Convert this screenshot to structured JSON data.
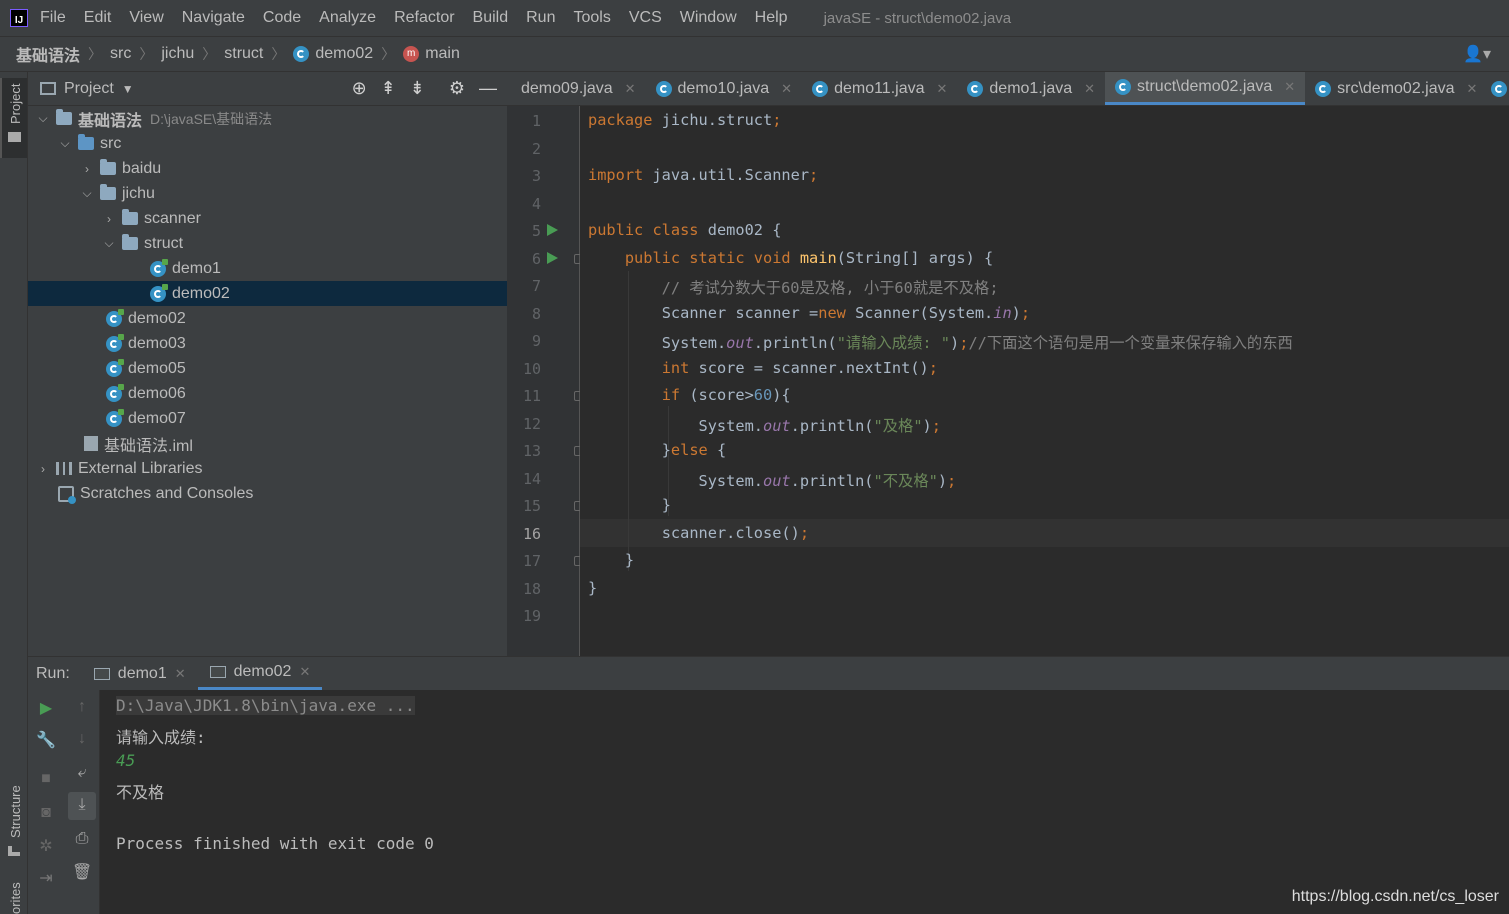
{
  "menubar": {
    "items": [
      "File",
      "Edit",
      "View",
      "Navigate",
      "Code",
      "Analyze",
      "Refactor",
      "Build",
      "Run",
      "Tools",
      "VCS",
      "Window",
      "Help"
    ],
    "window_title": "javaSE - struct\\demo02.java"
  },
  "breadcrumb": [
    "基础语法",
    "src",
    "jichu",
    "struct",
    "demo02",
    "main"
  ],
  "project": {
    "title": "Project",
    "tree": [
      {
        "label": "基础语法",
        "extra": "D:\\javaSE\\基础语法"
      },
      {
        "label": "src"
      },
      {
        "label": "baidu"
      },
      {
        "label": "jichu"
      },
      {
        "label": "scanner"
      },
      {
        "label": "struct"
      },
      {
        "label": "demo1"
      },
      {
        "label": "demo02"
      },
      {
        "label": "demo02"
      },
      {
        "label": "demo03"
      },
      {
        "label": "demo05"
      },
      {
        "label": "demo06"
      },
      {
        "label": "demo07"
      },
      {
        "label": "基础语法.iml"
      },
      {
        "label": "External Libraries"
      },
      {
        "label": "Scratches and Consoles"
      }
    ]
  },
  "tabs": [
    "demo09.java",
    "demo10.java",
    "demo11.java",
    "demo1.java",
    "struct\\demo02.java",
    "src\\demo02.java"
  ],
  "active_tab": "struct\\demo02.java",
  "editor": {
    "line_numbers": [
      "1",
      "2",
      "3",
      "4",
      "5",
      "6",
      "7",
      "8",
      "9",
      "10",
      "11",
      "12",
      "13",
      "14",
      "15",
      "16",
      "17",
      "18",
      "19"
    ],
    "current_line": "16",
    "lines": [
      "package jichu.struct;",
      "",
      "import java.util.Scanner;",
      "",
      "public class demo02 {",
      "    public static void main(String[] args) {",
      "        // 考试分数大于60是及格, 小于60就是不及格;",
      "        Scanner scanner =new Scanner(System.in);",
      "        System.out.println(\"请输入成绩: \");//下面这个语句是用一个变量来保存输入的东西",
      "        int score = scanner.nextInt();",
      "        if (score>60){",
      "            System.out.println(\"及格\");",
      "        }else {",
      "            System.out.println(\"不及格\");",
      "        }",
      "        scanner.close();",
      "    }",
      "}",
      ""
    ]
  },
  "run": {
    "label": "Run:",
    "tabs": [
      "demo1",
      "demo02"
    ],
    "active_tab": "demo02",
    "console": [
      "D:\\Java\\JDK1.8\\bin\\java.exe ...",
      "请输入成绩:",
      "45",
      "不及格",
      "",
      "Process finished with exit code 0"
    ]
  },
  "side_tabs": {
    "project": "Project",
    "structure": "Structure",
    "favorites": "orites"
  },
  "watermark": "https://blog.csdn.net/cs_loser"
}
